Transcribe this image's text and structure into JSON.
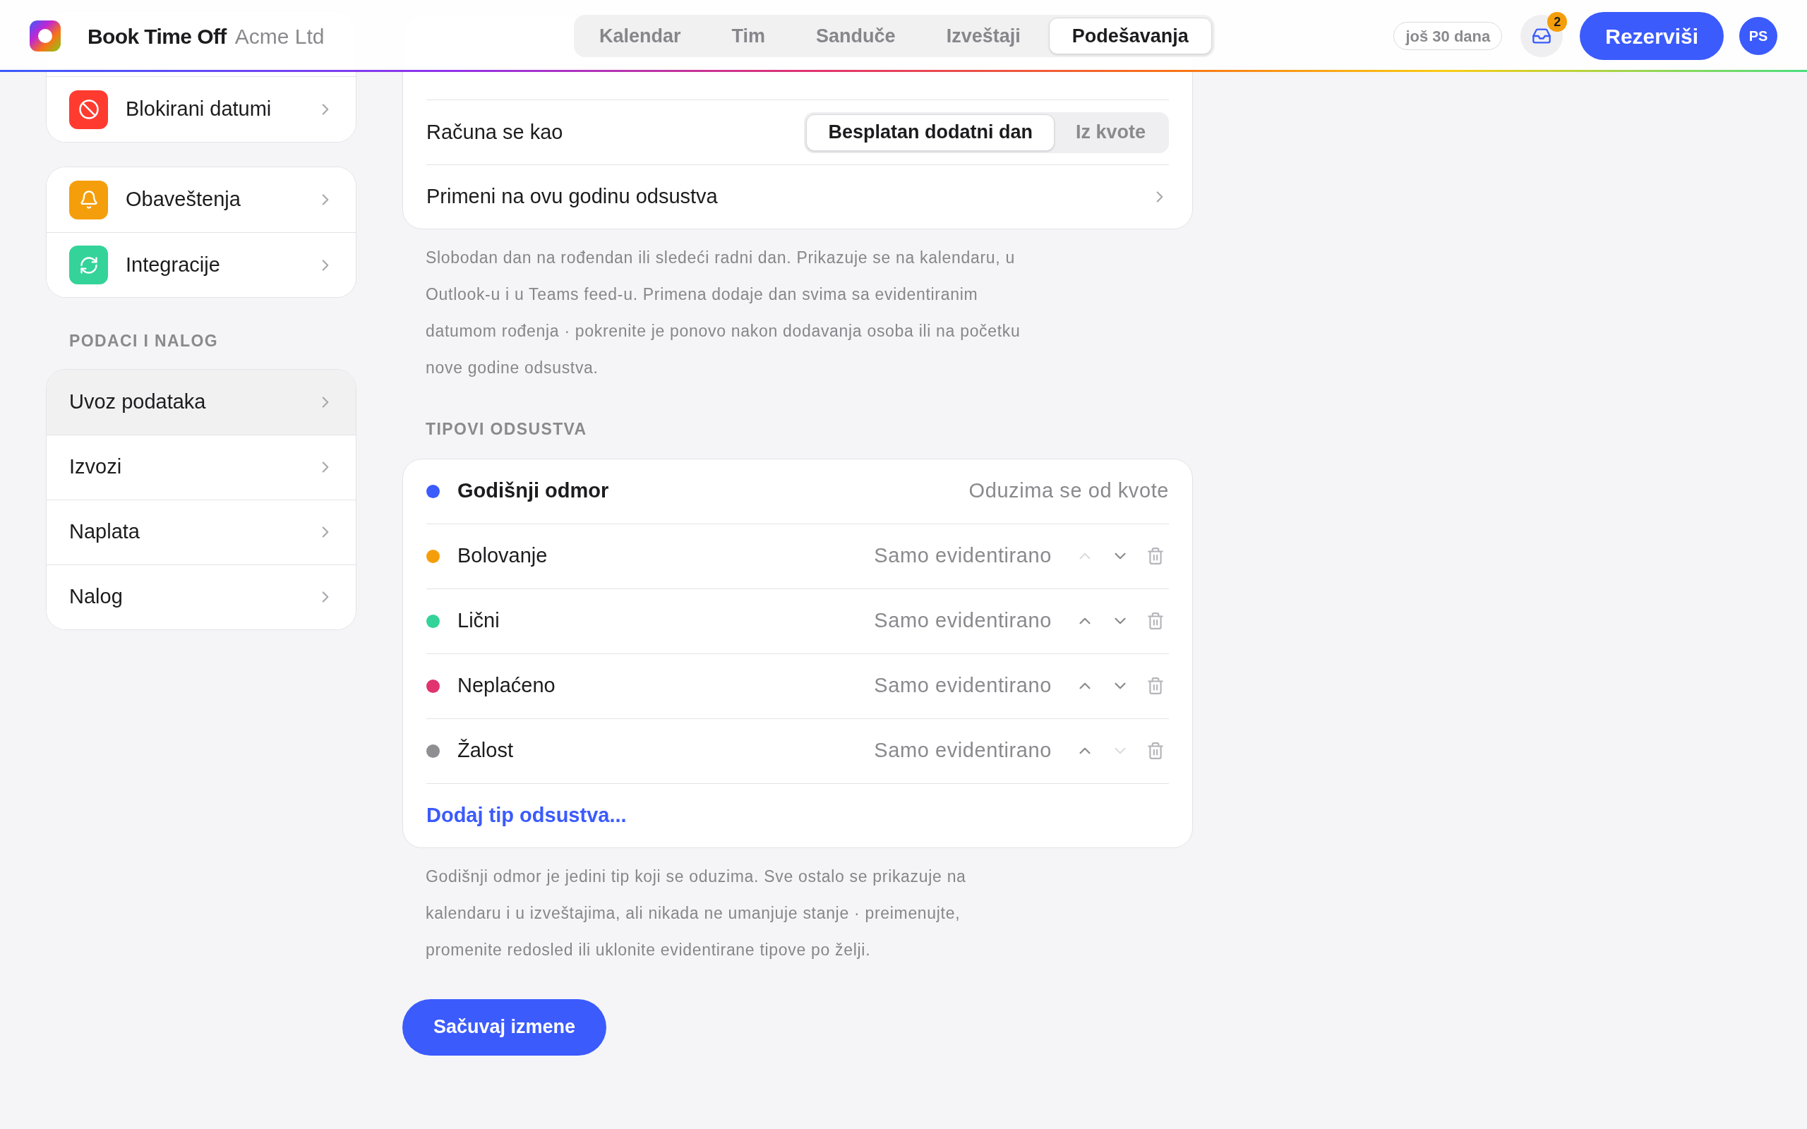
{
  "header": {
    "app_name": "Book Time Off",
    "org_name": "Acme Ltd",
    "nav": [
      {
        "label": "Kalendar",
        "selected": false
      },
      {
        "label": "Tim",
        "selected": false
      },
      {
        "label": "Sanduče",
        "selected": false
      },
      {
        "label": "Izveštaji",
        "selected": false
      },
      {
        "label": "Podešavanja",
        "selected": true
      }
    ],
    "trial": "još 30 dana",
    "inbox_badge": "2",
    "book_button": "Rezerviši",
    "avatar": "PS"
  },
  "sidebar": {
    "groups": [
      {
        "items": [
          {
            "label": "Blokirani datumi",
            "kind": "blocked",
            "color": "#ff3b30",
            "selected": false
          }
        ]
      },
      {
        "items": [
          {
            "label": "Obaveštenja",
            "kind": "notifications",
            "color": "#f59e0b",
            "selected": false
          },
          {
            "label": "Integracije",
            "kind": "integrations",
            "color": "#34d399",
            "selected": false
          }
        ]
      },
      {
        "title": "PODACI I NALOG",
        "items": [
          {
            "label": "Uvoz podataka",
            "kind": "plain",
            "selected": true
          },
          {
            "label": "Izvozi",
            "kind": "plain",
            "selected": false
          },
          {
            "label": "Naplata",
            "kind": "plain",
            "selected": false
          },
          {
            "label": "Nalog",
            "kind": "plain",
            "selected": false
          }
        ]
      }
    ]
  },
  "birthday": {
    "counts_as_label": "Računa se kao",
    "counts_as_options": [
      {
        "label": "Besplatan dodatni dan",
        "selected": true
      },
      {
        "label": "Iz kvote",
        "selected": false
      }
    ],
    "apply_label": "Primeni na ovu godinu odsustva",
    "note": "Slobodan dan na rođendan ili sledeći radni dan. Prikazuje se na kalendaru, u Outlook-u i u Teams feed-u. Primena dodaje dan svima sa evidentiranim datumom rođenja · pokrenite je ponovo nakon dodavanja osoba ili na početku nove godine odsustva."
  },
  "leave_types": {
    "title": "TIPOVI ODSUSTVA",
    "rows": [
      {
        "kind": "fixed",
        "name": "Godišnji odmor",
        "color": "#3b5bfd",
        "mode": "Oduzima se od kvote"
      },
      {
        "kind": "custom",
        "name": "Bolovanje",
        "color": "#f59e0b",
        "mode": "Samo evidentirano",
        "can_move_up": false,
        "can_move_down": true
      },
      {
        "kind": "custom",
        "name": "Lični",
        "color": "#34d399",
        "mode": "Samo evidentirano",
        "can_move_up": true,
        "can_move_down": true
      },
      {
        "kind": "custom",
        "name": "Neplaćeno",
        "color": "#e0336f",
        "mode": "Samo evidentirano",
        "can_move_up": true,
        "can_move_down": true
      },
      {
        "kind": "custom",
        "name": "Žalost",
        "color": "#8e8e93",
        "mode": "Samo evidentirano",
        "can_move_up": true,
        "can_move_down": false
      }
    ],
    "add_link": "Dodaj tip odsustva...",
    "note": "Godišnji odmor je jedini tip koji se oduzima. Sve ostalo se prikazuje na kalendaru i u izveštajima, ali nikada ne umanjuje stanje · preimenujte, promenite redosled ili uklonite evidentirane tipove po želji."
  },
  "save_button": "Sačuvaj izmene"
}
